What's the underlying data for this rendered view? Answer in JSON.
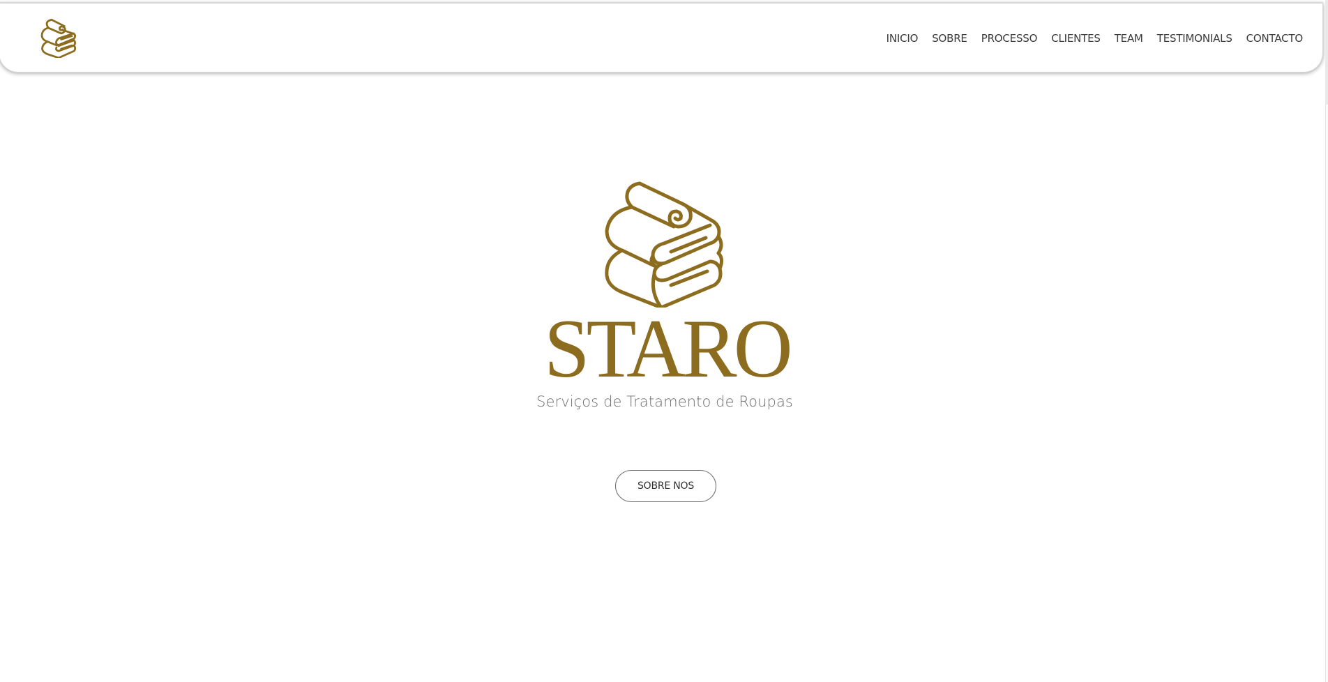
{
  "colors": {
    "brand_gold": "#8c6c1e",
    "nav_text": "#3a3a3a",
    "tagline_text": "#6e6e6e",
    "background": "#ffffff"
  },
  "header": {
    "logo_icon": "folded-towels-icon",
    "nav": [
      {
        "label": "INICIO"
      },
      {
        "label": "SOBRE"
      },
      {
        "label": "PROCESSO"
      },
      {
        "label": "CLIENTES"
      },
      {
        "label": "TEAM"
      },
      {
        "label": "TESTIMONIALS"
      },
      {
        "label": "CONTACTO"
      }
    ]
  },
  "hero": {
    "emblem_icon": "folded-towels-icon",
    "brand_name": "STARO",
    "tagline": "Serviços de Tratamento de Roupas",
    "cta_label": "SOBRE NOS"
  }
}
